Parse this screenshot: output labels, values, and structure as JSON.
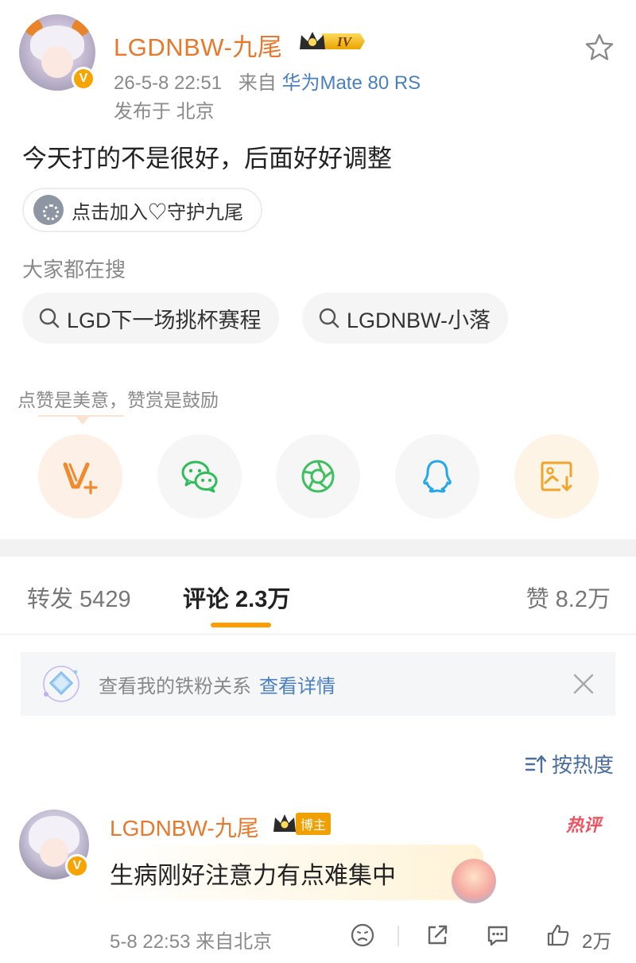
{
  "post": {
    "author_name": "LGDNBW-九尾",
    "vip_level": "IV",
    "verified_mark": "V",
    "timestamp": "26-5-8 22:51",
    "source_prefix": "来自",
    "device": "华为Mate 80 RS",
    "location": "发布于 北京",
    "content": "今天打的不是很好，后面好好调整",
    "join_chip_label": "点击加入♡守护九尾"
  },
  "search": {
    "title": "大家都在搜",
    "chips": [
      "LGD下一场挑杯赛程",
      "LGDNBW-小落"
    ]
  },
  "praise": {
    "text": "点赞是美意，赞赏是鼓励"
  },
  "share": {
    "items": [
      {
        "icon": "weibo-v-plus-icon",
        "color": "#f08a2c"
      },
      {
        "icon": "wechat-icon",
        "color": "#2fbd5a"
      },
      {
        "icon": "moments-icon",
        "color": "#3fbf5f"
      },
      {
        "icon": "qq-icon",
        "color": "#23a8ea"
      },
      {
        "icon": "save-image-icon",
        "color": "#f0a52a"
      }
    ]
  },
  "tabs": {
    "repost": "转发 5429",
    "comment": "评论 2.3万",
    "like": "赞 8.2万"
  },
  "fan_banner": {
    "text": "查看我的铁粉关系",
    "link": "查看详情"
  },
  "sort": {
    "label": "按热度"
  },
  "comment": {
    "author_name": "LGDNBW-九尾",
    "verified_mark": "V",
    "badge_label": "博主",
    "hot_tag": "热评",
    "text": "生病刚好注意力有点难集中",
    "time": "5-8 22:53 来自北京",
    "like_count": "2万"
  },
  "colors": {
    "accent_orange": "#ff9d00",
    "name_orange": "#e8782b",
    "link_blue": "#4a7fc1"
  }
}
